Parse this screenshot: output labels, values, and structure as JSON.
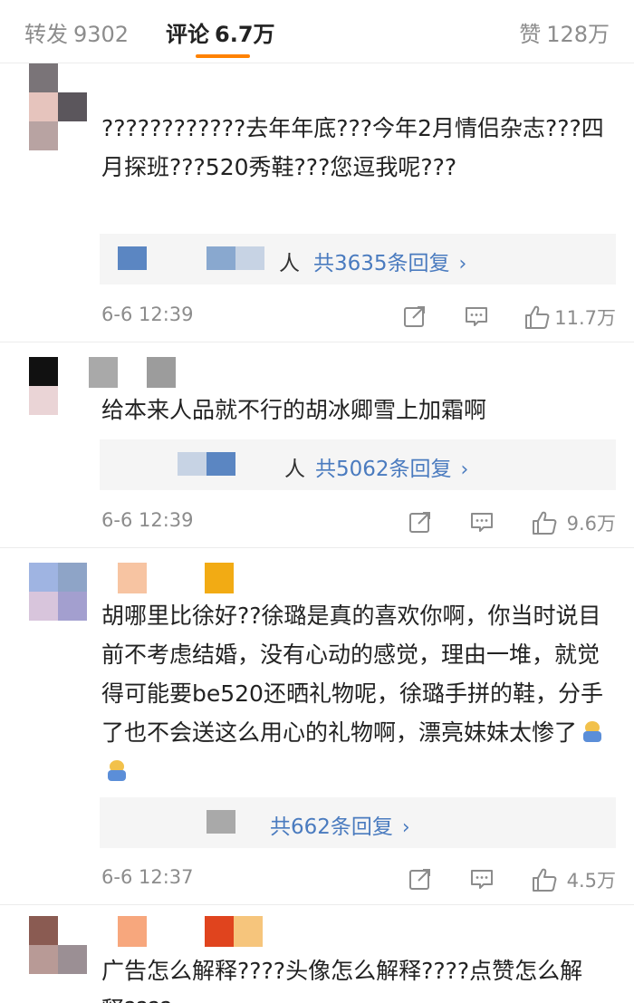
{
  "tabs": {
    "repost": {
      "label": "转发",
      "count": "9302"
    },
    "comments": {
      "label": "评论",
      "count": "6.7万"
    },
    "likes": {
      "label": "赞",
      "count": "128万"
    }
  },
  "colors": {
    "accent": "#ff8200",
    "link": "#4a7bbf",
    "muted": "#8c8c8c"
  },
  "comments": [
    {
      "text": "????????????去年年底???今年2月情侣杂志???四月探班???520秀鞋???您逗我呢???",
      "reply_suffix": "人",
      "reply_link": "共3635条回复",
      "time": "6-6 12:39",
      "likes": "11.7万"
    },
    {
      "text": "给本来人品就不行的胡冰卿雪上加霜啊",
      "reply_suffix": "人",
      "reply_link": "共5062条回复",
      "time": "6-6 12:39",
      "likes": "9.6万"
    },
    {
      "text": "胡哪里比徐好??徐璐是真的喜欢你啊，你当时说目前不考虑结婚，没有心动的感觉，理由一堆，就觉得可能要be520还晒礼物呢，徐璐手拼的鞋，分手了也不会送这么用心的礼物啊，漂亮妹妹太惨了",
      "reply_suffix": "",
      "reply_link": "共662条回复",
      "time": "6-6 12:37",
      "likes": "4.5万"
    },
    {
      "text": "广告怎么解释????头像怎么解释????点赞怎么解释????"
    }
  ],
  "icons": {
    "share": "share-icon",
    "comment": "comment-icon",
    "like": "thumbs-up-icon",
    "chevron": "chevron-right-icon"
  }
}
